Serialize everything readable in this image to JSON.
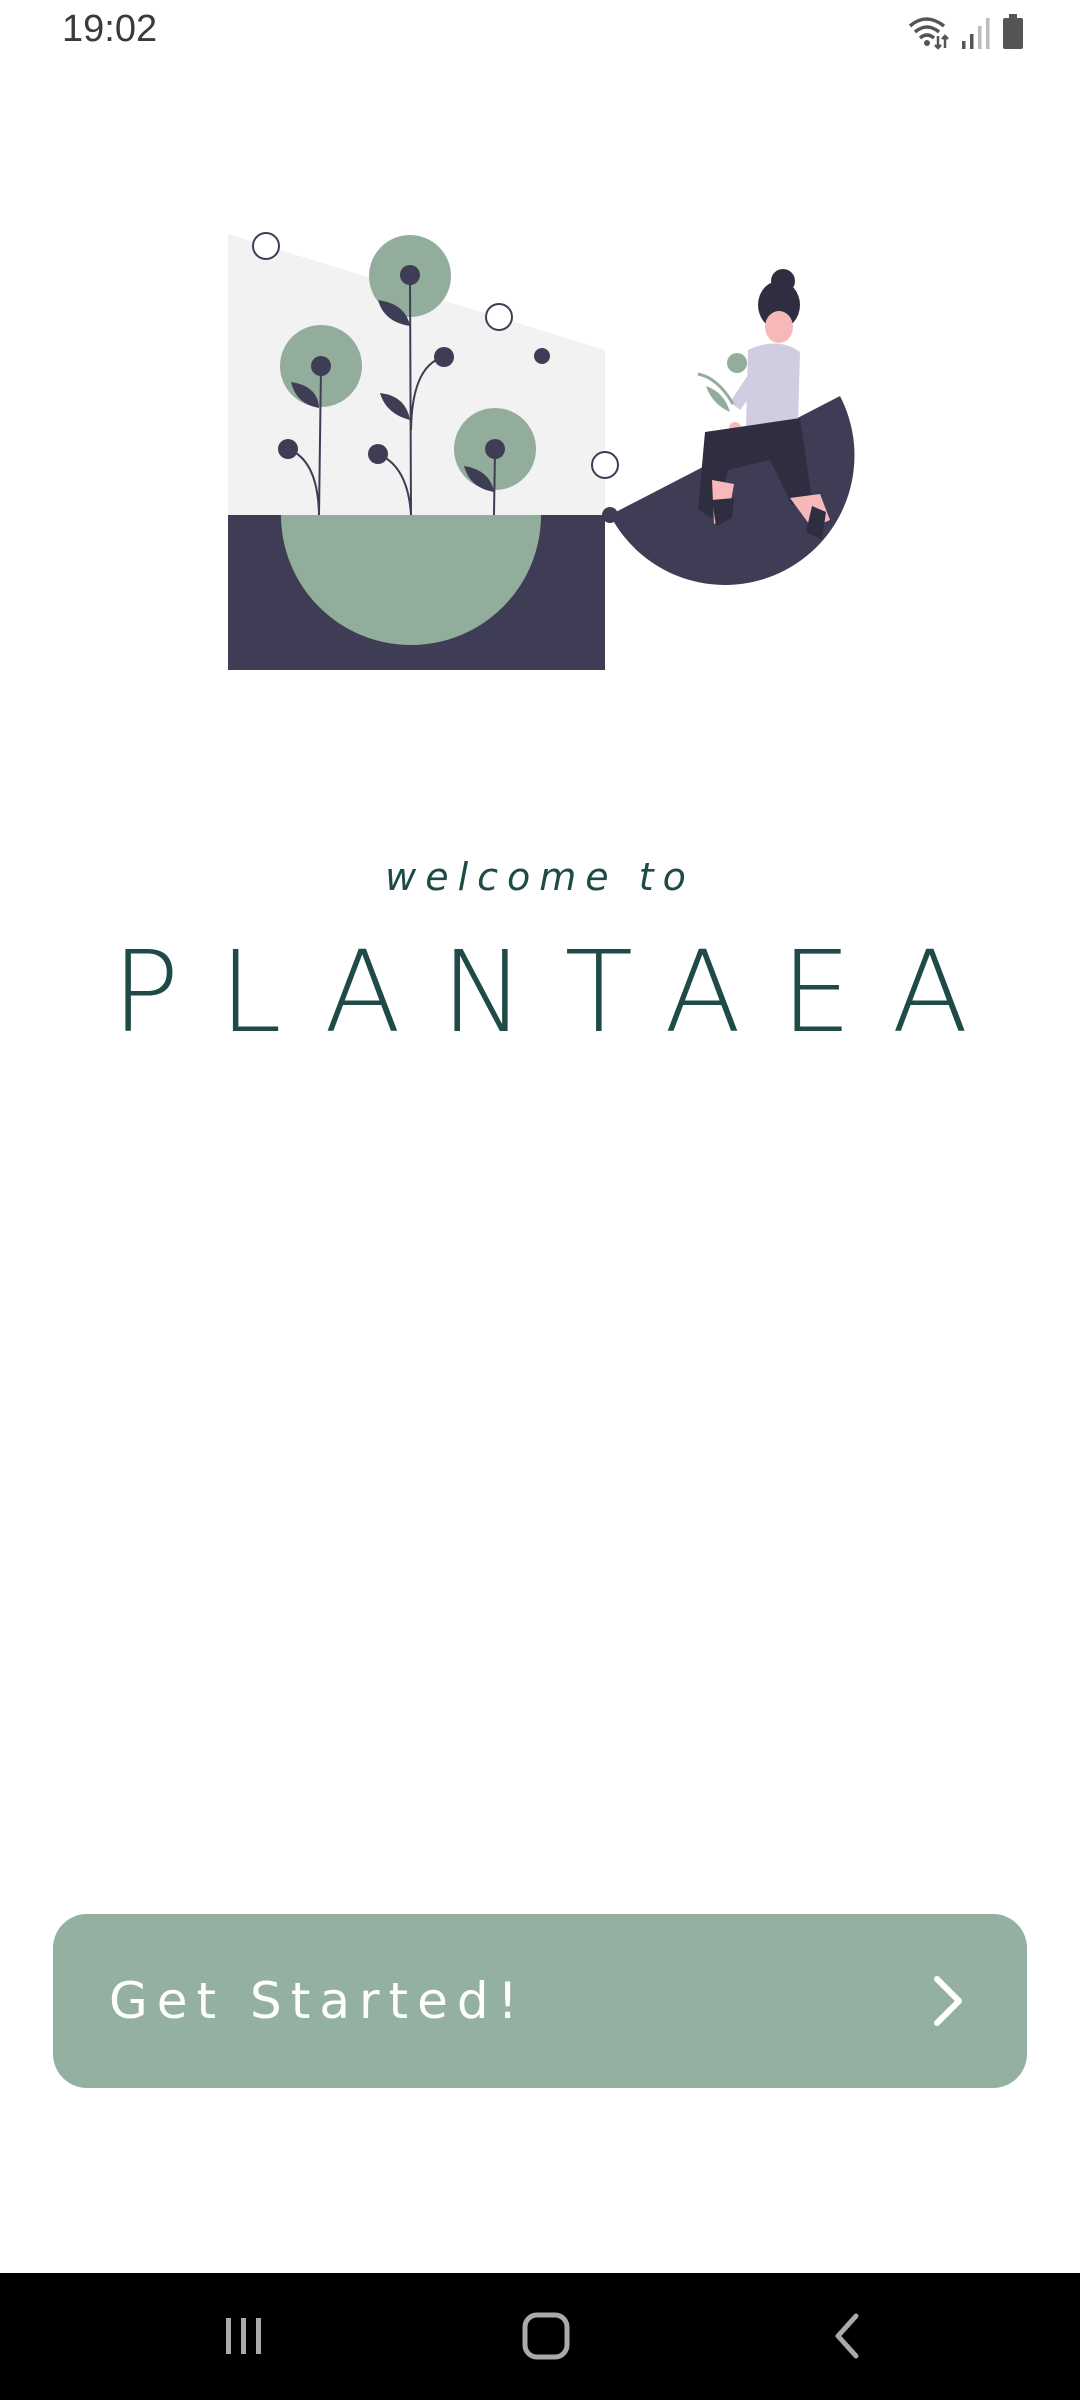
{
  "status_bar": {
    "time": "19:02",
    "icons": [
      "wifi-icon",
      "signal-icon",
      "battery-icon"
    ]
  },
  "illustration": {
    "name": "plant-woman-illustration",
    "colors": {
      "sage": "#93ad9c",
      "navy": "#3f3d56",
      "wall": "#f2f2f2",
      "skin": "#f6b8b8",
      "sweater": "#d0cde1"
    }
  },
  "welcome": {
    "subtitle": "welcome to",
    "title": "PLANTAEA"
  },
  "cta": {
    "label": "Get Started!",
    "icon": "chevron-right-icon"
  },
  "nav_bar": {
    "buttons": [
      "recent-apps-icon",
      "home-icon",
      "back-icon"
    ]
  },
  "theme": {
    "accent": "#94b0a0",
    "text": "#1e4a48"
  }
}
